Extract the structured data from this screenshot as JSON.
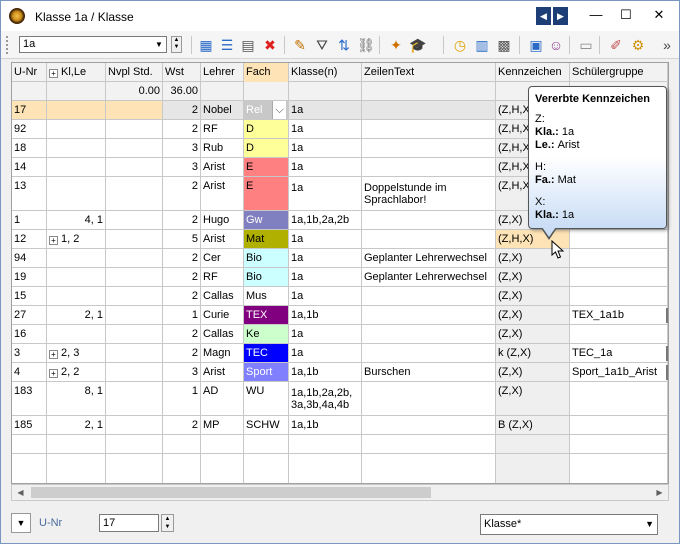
{
  "window": {
    "title": "Klasse 1a / Klasse",
    "controls": {
      "prev": "◀",
      "next": "▶",
      "minimize": "—",
      "maximize": "☐",
      "close": "✕"
    }
  },
  "toolbar": {
    "class_combo_value": "1a",
    "icons": [
      "grid-add-icon",
      "list-icon",
      "new-doc-icon",
      "delete-icon",
      "pen-icon",
      "filter-icon",
      "sort-icon",
      "link-icon",
      "wand-icon",
      "graduation-cap-icon",
      "clock-icon",
      "calendar-icon",
      "settings-grid-icon",
      "report-icon",
      "people-icon",
      "monitor-icon",
      "brush-icon",
      "gear-icon",
      "overflow-icon"
    ]
  },
  "grid": {
    "columns": [
      "U-Nr",
      "Kl,Le",
      "Nvpl Std.",
      "Wst",
      "Lehrer",
      "Fach",
      "Klasse(n)",
      "ZeilenText",
      "Kennzeichen",
      "Schülergruppe"
    ],
    "totals": {
      "nvpl": "0.00",
      "wst": "36.00"
    },
    "rows": [
      {
        "unr": "17",
        "klle": "",
        "plus": false,
        "wst": "2",
        "lehrer": "Nobel",
        "fach": "Rel",
        "klassen": "1a",
        "text": "",
        "kz": "(Z,H,X)",
        "sg": ""
      },
      {
        "unr": "92",
        "klle": "",
        "plus": false,
        "wst": "2",
        "lehrer": "RF",
        "fach": "D",
        "klassen": "1a",
        "text": "",
        "kz": "(Z,H,X)",
        "sg": ""
      },
      {
        "unr": "18",
        "klle": "",
        "plus": false,
        "wst": "3",
        "lehrer": "Rub",
        "fach": "D",
        "klassen": "1a",
        "text": "",
        "kz": "(Z,H,X)",
        "sg": ""
      },
      {
        "unr": "14",
        "klle": "",
        "plus": false,
        "wst": "3",
        "lehrer": "Arist",
        "fach": "E",
        "klassen": "1a",
        "text": "",
        "kz": "(Z,H,X)",
        "sg": ""
      },
      {
        "unr": "13",
        "klle": "",
        "plus": false,
        "wst": "2",
        "lehrer": "Arist",
        "fach": "E",
        "klassen": "1a",
        "text": "Doppelstunde im Sprachlabor!",
        "kz": "(Z,H,X)",
        "sg": ""
      },
      {
        "unr": "1",
        "klle": "4, 1",
        "plus": false,
        "wst": "2",
        "lehrer": "Hugo",
        "fach": "Gw",
        "klassen": "1a,1b,2a,2b",
        "text": "",
        "kz": "(Z,X)",
        "sg": ""
      },
      {
        "unr": "12",
        "klle": "1, 2",
        "plus": true,
        "wst": "5",
        "lehrer": "Arist",
        "fach": "Mat",
        "klassen": "1a",
        "text": "",
        "kz": "(Z,H,X)",
        "sg": ""
      },
      {
        "unr": "94",
        "klle": "",
        "plus": false,
        "wst": "2",
        "lehrer": "Cer",
        "fach": "Bio",
        "klassen": "1a",
        "text": "Geplanter Lehrerwechsel",
        "kz": "(Z,X)",
        "sg": ""
      },
      {
        "unr": "19",
        "klle": "",
        "plus": false,
        "wst": "2",
        "lehrer": "RF",
        "fach": "Bio",
        "klassen": "1a",
        "text": "Geplanter Lehrerwechsel",
        "kz": "(Z,X)",
        "sg": ""
      },
      {
        "unr": "15",
        "klle": "",
        "plus": false,
        "wst": "2",
        "lehrer": "Callas",
        "fach": "Mus",
        "klassen": "1a",
        "text": "",
        "kz": "(Z,X)",
        "sg": ""
      },
      {
        "unr": "27",
        "klle": "2, 1",
        "plus": false,
        "wst": "1",
        "lehrer": "Curie",
        "fach": "TEX",
        "klassen": "1a,1b",
        "text": "",
        "kz": "(Z,X)",
        "sg": "TEX_1a1b"
      },
      {
        "unr": "16",
        "klle": "",
        "plus": false,
        "wst": "2",
        "lehrer": "Callas",
        "fach": "Ke",
        "klassen": "1a",
        "text": "",
        "kz": "(Z,X)",
        "sg": ""
      },
      {
        "unr": "3",
        "klle": "2, 3",
        "plus": true,
        "wst": "2",
        "lehrer": "Magn",
        "fach": "TEC",
        "klassen": "1a",
        "text": "",
        "kz": "k (Z,X)",
        "sg": "TEC_1a"
      },
      {
        "unr": "4",
        "klle": "2, 2",
        "plus": true,
        "wst": "3",
        "lehrer": "Arist",
        "fach": "Sport",
        "klassen": "1a,1b",
        "text": "Burschen",
        "kz": "(Z,X)",
        "sg": "Sport_1a1b_Arist"
      },
      {
        "unr": "183",
        "klle": "8, 1",
        "plus": false,
        "wst": "1",
        "lehrer": "AD",
        "fach": "WU",
        "klassen": "1a,1b,2a,2b, 3a,3b,4a,4b",
        "text": "",
        "kz": "(Z,X)",
        "sg": ""
      },
      {
        "unr": "185",
        "klle": "2, 1",
        "plus": false,
        "wst": "2",
        "lehrer": "MP",
        "fach": "SCHW",
        "klassen": "1a,1b",
        "text": "",
        "kz": "B (Z,X)",
        "sg": ""
      }
    ],
    "fach_colors": {
      "Rel": "#c8c8c8",
      "D": "#ffff99",
      "E": "#ff8080",
      "Gw": "#8080c0",
      "Mat": "#b0b000",
      "Bio": "#ccffff",
      "Mus": "#ffffff",
      "TEX": "#800080",
      "Ke": "#ccffcc",
      "TEC": "#0000ff",
      "Sport": "#8080ff",
      "WU": "#ffffff",
      "SCHW": "#ffffff"
    }
  },
  "tooltip": {
    "title": "Vererbte Kennzeichen",
    "sections": [
      {
        "code": "Z:",
        "lines": [
          {
            "label": "Kla.:",
            "value": "1a"
          },
          {
            "label": "Le.:",
            "value": "Arist"
          }
        ]
      },
      {
        "code": "H:",
        "lines": [
          {
            "label": "Fa.:",
            "value": "Mat"
          }
        ]
      },
      {
        "code": "X:",
        "lines": [
          {
            "label": "Kla.:",
            "value": "1a"
          }
        ]
      }
    ]
  },
  "statusbar": {
    "field_label": "U-Nr",
    "field_value": "17",
    "view_select": "Klasse*"
  }
}
